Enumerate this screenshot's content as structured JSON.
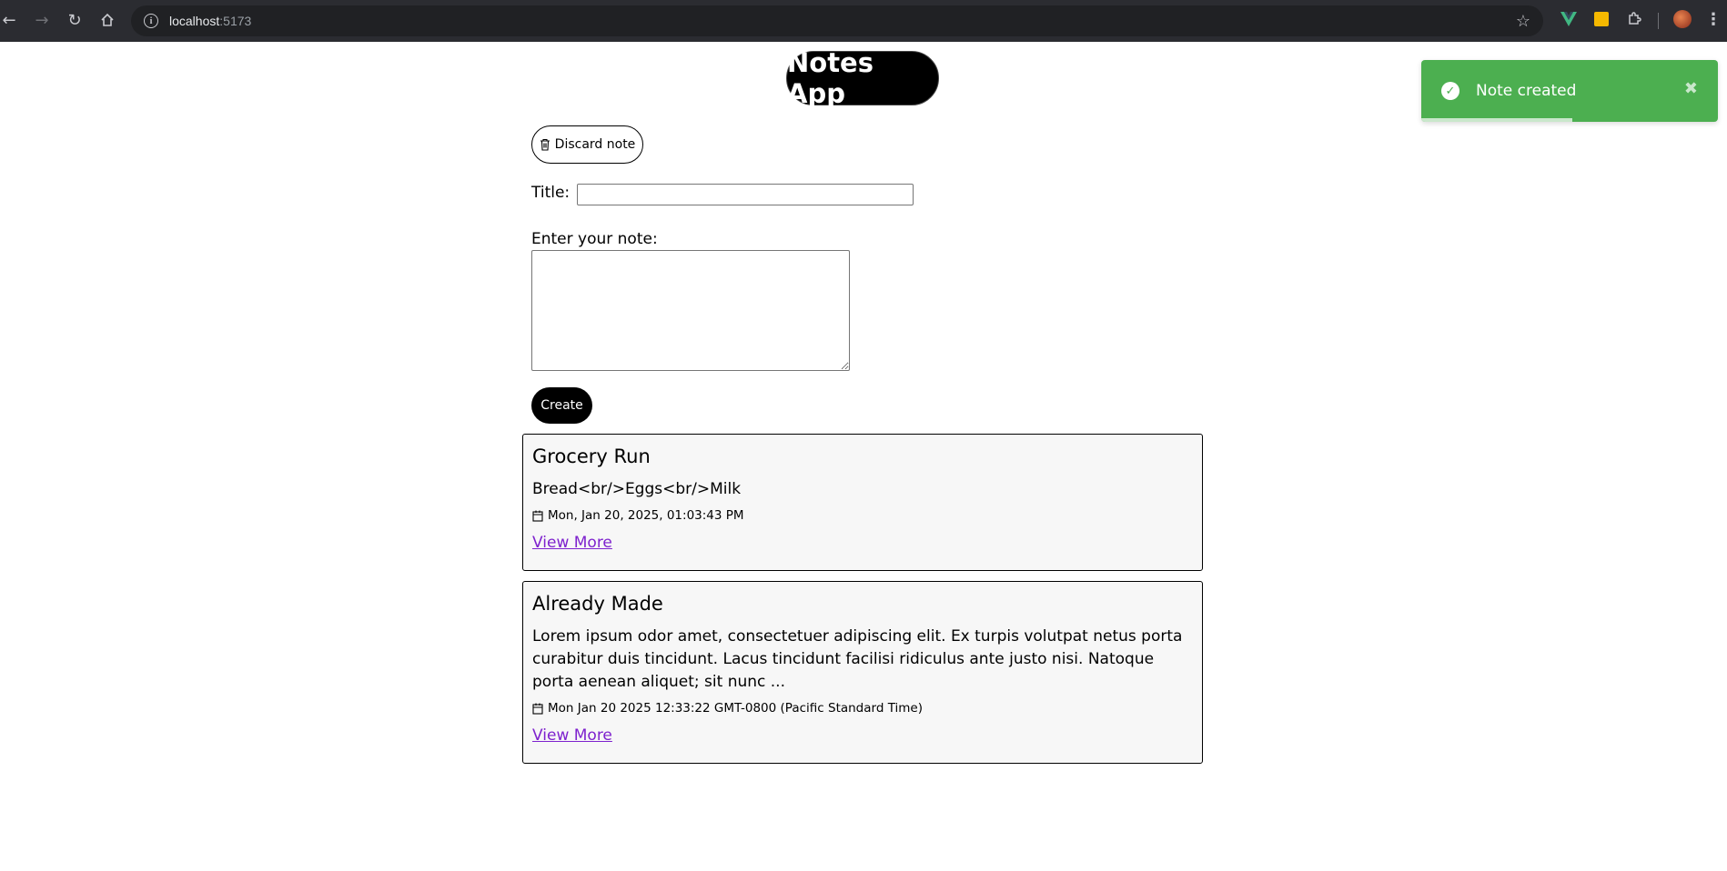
{
  "browser": {
    "url_host": "localhost",
    "url_port": ":5173",
    "icons": [
      "back-icon",
      "forward-icon",
      "reload-icon",
      "home-icon",
      "site-info-icon",
      "bookmark-star-icon",
      "vue-devtools-icon",
      "extension-yellow-icon",
      "extensions-puzzle-icon",
      "profile-avatar-icon",
      "more-menu-icon"
    ]
  },
  "app": {
    "title": "Notes App",
    "discard_label": "Discard note",
    "title_label": "Title:",
    "title_value": "",
    "note_label": "Enter your note:",
    "note_value": "",
    "create_label": "Create"
  },
  "notes": [
    {
      "title": "Grocery Run",
      "body": "Bread<br/>Eggs<br/>Milk",
      "date": "Mon, Jan 20, 2025, 01:03:43 PM",
      "link": "View More"
    },
    {
      "title": "Already Made",
      "body": "Lorem ipsum odor amet, consectetuer adipiscing elit. Ex turpis volutpat netus porta curabitur duis tincidunt. Lacus tincidunt facilisi ridiculus ante justo nisi. Natoque porta aenean aliquet; sit nunc ...",
      "date": "Mon Jan 20 2025 12:33:22 GMT-0800 (Pacific Standard Time)",
      "link": "View More"
    }
  ],
  "toast": {
    "message": "Note created",
    "progress_fraction": 0.51,
    "color": "#4caf50"
  }
}
